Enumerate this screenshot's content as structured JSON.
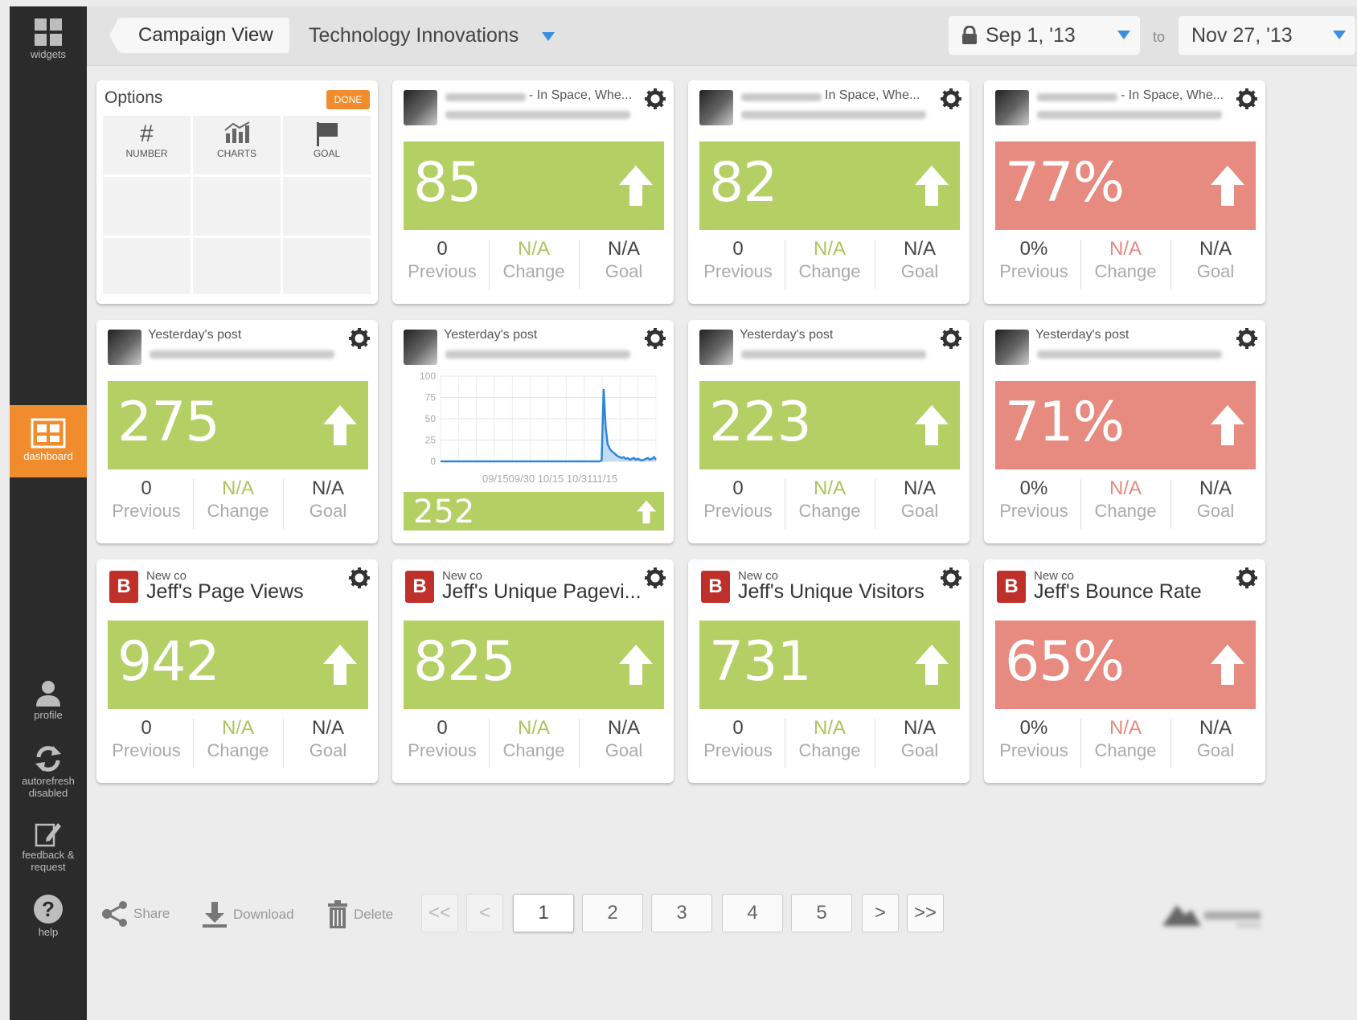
{
  "sidebar": {
    "items": [
      {
        "label": "widgets",
        "icon": "grid-icon"
      },
      {
        "label": "dashboard",
        "icon": "dashboard-icon"
      },
      {
        "label": "profile",
        "icon": "user-icon"
      },
      {
        "label": "autorefresh disabled",
        "icon": "refresh-icon"
      },
      {
        "label": "feedback & request",
        "icon": "edit-icon"
      },
      {
        "label": "help",
        "icon": "help-icon"
      }
    ]
  },
  "header": {
    "campaign_view": "Campaign View",
    "campaign_name": "Technology Innovations",
    "date_from": "Sep 1, '13",
    "to_label": "to",
    "date_to": "Nov 27, '13"
  },
  "options": {
    "title": "Options",
    "done": "DONE",
    "cells": [
      {
        "label": "NUMBER",
        "icon": "hash-icon"
      },
      {
        "label": "CHARTS",
        "icon": "chart-icon"
      },
      {
        "label": "GOAL",
        "icon": "flag-icon"
      }
    ]
  },
  "labels": {
    "previous": "Previous",
    "change": "Change",
    "goal": "Goal"
  },
  "widgets_row1": [
    {
      "pre": "- In Space, Whe...",
      "value": "85",
      "color": "green",
      "previous": "0",
      "change": "N/A",
      "goal": "N/A"
    },
    {
      "pre": "In Space, Whe...",
      "value": "82",
      "color": "green",
      "previous": "0",
      "change": "N/A",
      "goal": "N/A"
    },
    {
      "pre": "- In Space, Whe...",
      "value": "77%",
      "color": "red",
      "previous": "0%",
      "change": "N/A",
      "goal": "N/A"
    }
  ],
  "widgets_row2": [
    {
      "pre": "Yesterday's post",
      "value": "275",
      "color": "green",
      "previous": "0",
      "change": "N/A",
      "goal": "N/A"
    },
    {
      "pre": "Yesterday's post",
      "value": "252",
      "color": "green"
    },
    {
      "pre": "Yesterday's post",
      "value": "223",
      "color": "green",
      "previous": "0",
      "change": "N/A",
      "goal": "N/A"
    },
    {
      "pre": "Yesterday's post",
      "value": "71%",
      "color": "red",
      "previous": "0%",
      "change": "N/A",
      "goal": "N/A"
    }
  ],
  "widgets_row3": [
    {
      "pre": "New co",
      "title": "Jeff's Page Views",
      "value": "942",
      "color": "green",
      "previous": "0",
      "change": "N/A",
      "goal": "N/A"
    },
    {
      "pre": "New co",
      "title": "Jeff's Unique Pagevi...",
      "value": "825",
      "color": "green",
      "previous": "0",
      "change": "N/A",
      "goal": "N/A"
    },
    {
      "pre": "New co",
      "title": "Jeff's Unique Visitors",
      "value": "731",
      "color": "green",
      "previous": "0",
      "change": "N/A",
      "goal": "N/A"
    },
    {
      "pre": "New co",
      "title": "Jeff's Bounce Rate",
      "value": "65%",
      "color": "red",
      "previous": "0%",
      "change": "N/A",
      "goal": "N/A"
    }
  ],
  "chart_data": {
    "type": "line",
    "x_ticks": [
      "09/15",
      "09/30",
      "10/15",
      "10/31",
      "11/15"
    ],
    "y_ticks": [
      "100",
      "75",
      "50",
      "25",
      "0"
    ],
    "ylim": [
      0,
      100
    ],
    "series": [
      {
        "values": [
          0,
          0,
          0,
          0,
          0,
          0,
          0,
          0,
          0,
          0,
          0,
          0,
          0,
          0,
          0,
          0,
          0,
          0,
          0,
          0,
          0,
          0,
          0,
          0,
          0,
          0,
          0,
          0,
          0,
          0,
          0,
          0,
          0,
          0,
          0,
          0,
          0,
          0,
          0,
          0,
          0,
          0,
          0,
          0,
          0,
          0,
          0,
          0,
          0,
          0,
          0,
          0,
          0,
          0,
          0,
          0,
          0,
          0,
          0,
          0,
          0,
          0,
          0,
          0,
          0,
          0,
          0,
          0,
          0,
          0,
          0,
          0,
          0,
          0,
          0,
          0,
          0,
          0,
          0,
          0,
          1,
          85,
          40,
          20,
          15,
          12,
          10,
          8,
          6,
          5,
          4,
          5,
          3,
          4,
          2,
          3,
          4,
          2,
          3,
          2,
          1,
          2,
          3,
          4,
          2,
          3,
          5,
          2
        ]
      }
    ],
    "colors": {
      "line": "#2e86d8",
      "fill": "#9cc6ee"
    }
  },
  "pagination": {
    "first": "<<",
    "prev": "<",
    "pages": [
      "1",
      "2",
      "3",
      "4",
      "5"
    ],
    "next": ">",
    "last": ">>",
    "active": "1"
  },
  "footer": {
    "share": "Share",
    "download": "Download",
    "delete": "Delete"
  },
  "colors": {
    "green": "#b4cf63",
    "red": "#e78a80",
    "orange": "#f08c2c",
    "sidebar": "#2b2b2b"
  }
}
